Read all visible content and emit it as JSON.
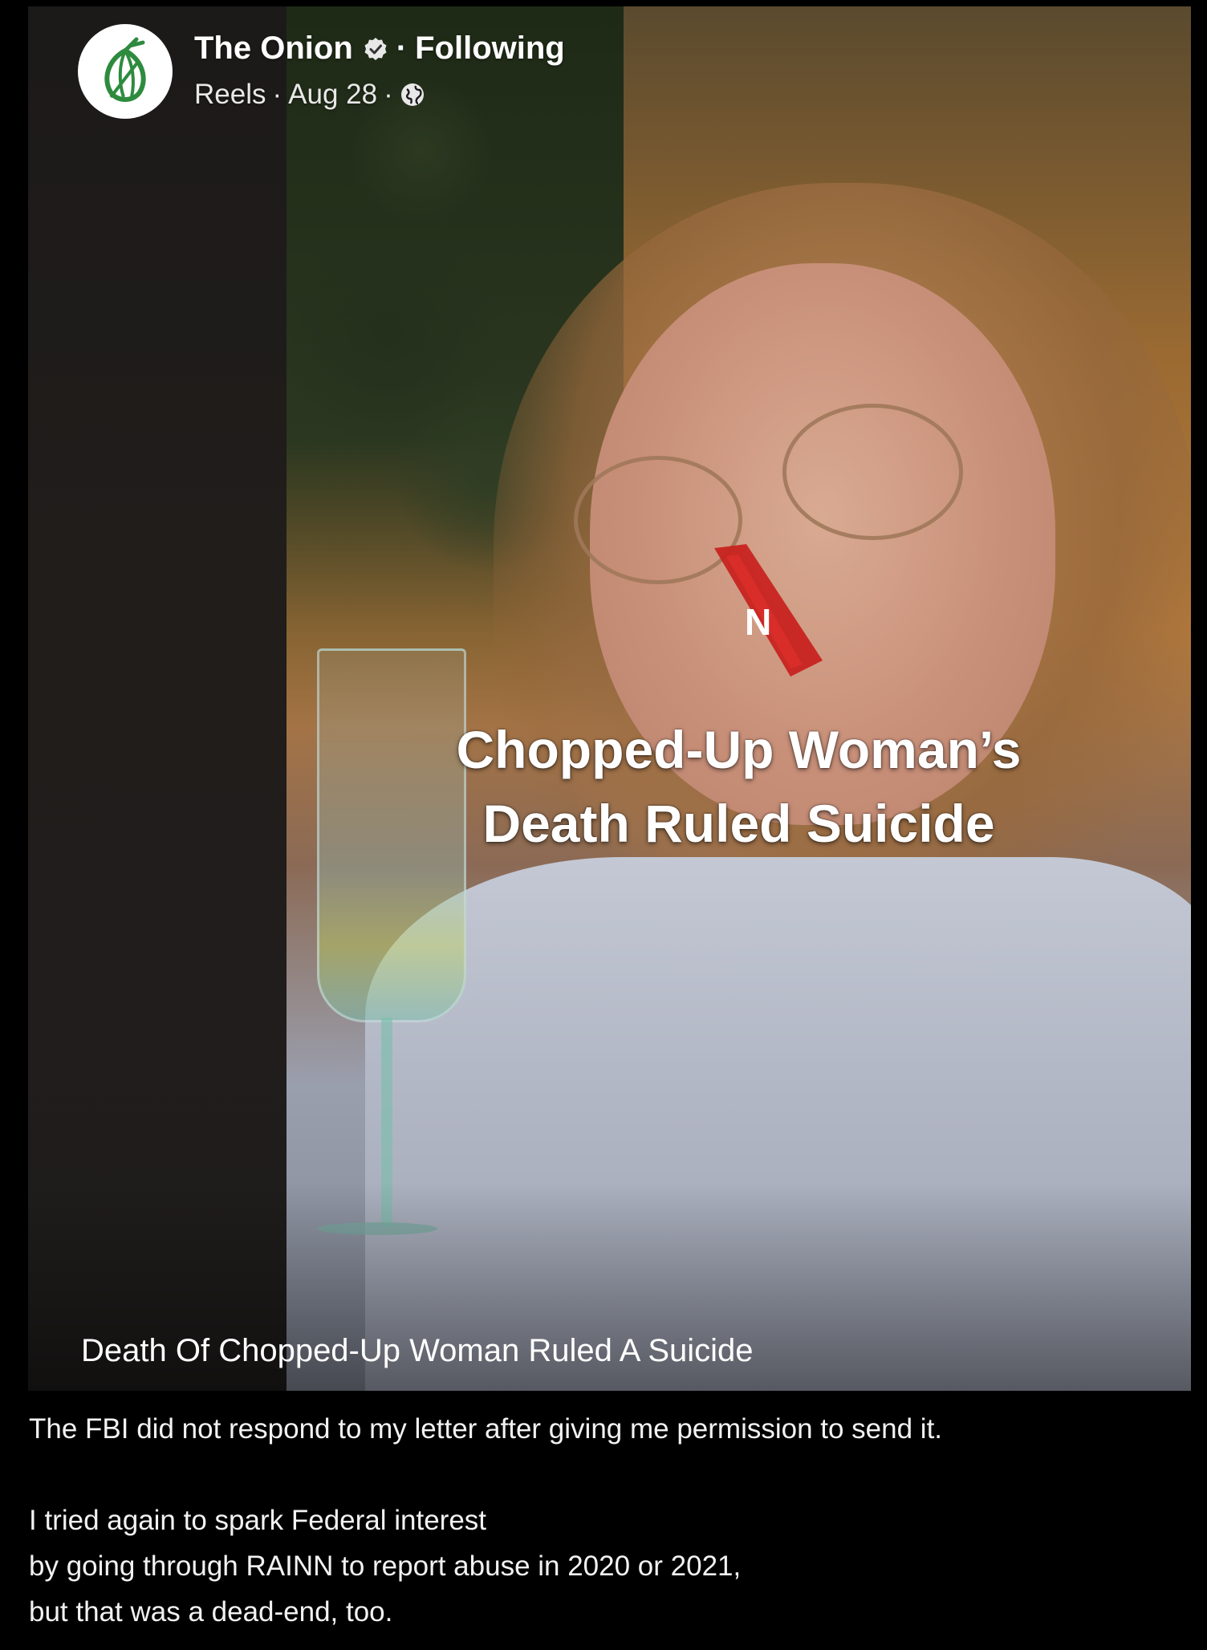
{
  "post": {
    "page_name": "The Onion",
    "follow_status": "Following",
    "separator": "·",
    "source": "Reels",
    "date": "Aug 28",
    "icons": {
      "avatar": "onion-logo-icon",
      "verified": "verified-badge-icon",
      "audience": "globe-icon"
    }
  },
  "video": {
    "headline_line1": "Chopped-Up Woman’s",
    "headline_line2": "Death Ruled Suicide",
    "caption": "Death Of Chopped-Up Woman Ruled A Suicide"
  },
  "body": {
    "paragraph1": "The FBI did not respond to my letter after giving me permission to send it.",
    "line2": "I tried again to spark Federal interest",
    "line3": "by going through RAINN to report abuse in 2020 or 2021,",
    "line4": "but that was a dead-end, too."
  },
  "colors": {
    "background": "#000000",
    "onion_green": "#2e8b3e",
    "onion_red": "#c8201c",
    "text": "#ffffff"
  }
}
